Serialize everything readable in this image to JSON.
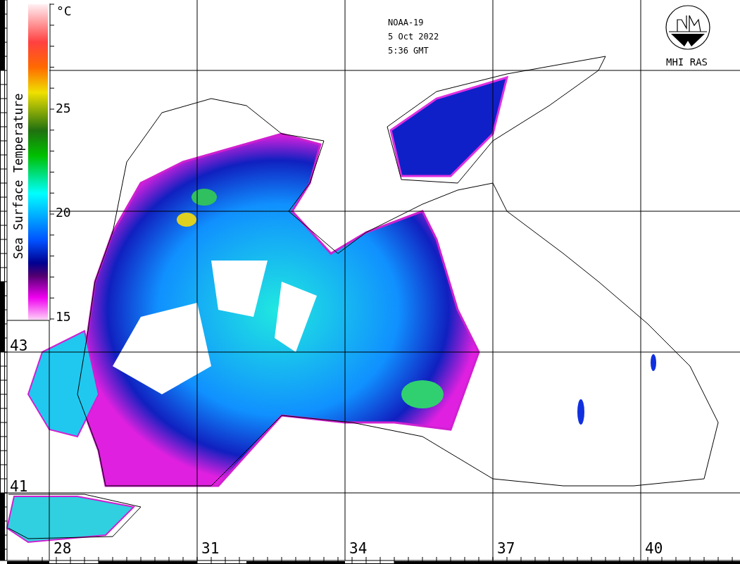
{
  "header": {
    "satellite": "NOAA-19",
    "date": "5 Oct 2022",
    "time": "5:36 GMT"
  },
  "logo": {
    "label": "MHI RAS"
  },
  "legend": {
    "title": "Sea Surface Temperature",
    "unit": "°C",
    "ticks": [
      {
        "label": "25"
      },
      {
        "label": "20"
      },
      {
        "label": "15"
      }
    ]
  },
  "map": {
    "latitude_labels": [
      "43",
      "41"
    ],
    "longitude_labels": [
      "28",
      "31",
      "34",
      "37",
      "40"
    ]
  }
}
